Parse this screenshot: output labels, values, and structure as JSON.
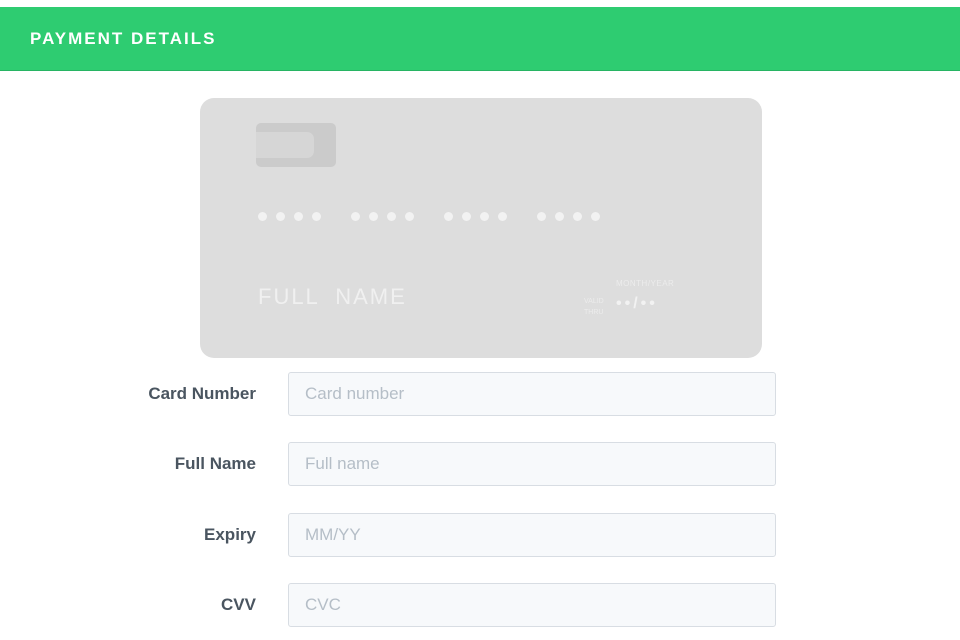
{
  "header": {
    "title": "PAYMENT DETAILS",
    "color": "#2ecc71"
  },
  "card_preview": {
    "number_groups": [
      4,
      4,
      4,
      4
    ],
    "name": "FULL  NAME",
    "valid_label": "VALID THRU",
    "month_year_label": "MONTH/YEAR",
    "expiry_mask": "••/••"
  },
  "form": {
    "card_number": {
      "label": "Card Number",
      "placeholder": "Card number"
    },
    "full_name": {
      "label": "Full Name",
      "placeholder": "Full name"
    },
    "expiry": {
      "label": "Expiry",
      "placeholder": "MM/YY"
    },
    "cvv": {
      "label": "CVV",
      "placeholder": "CVC"
    }
  }
}
